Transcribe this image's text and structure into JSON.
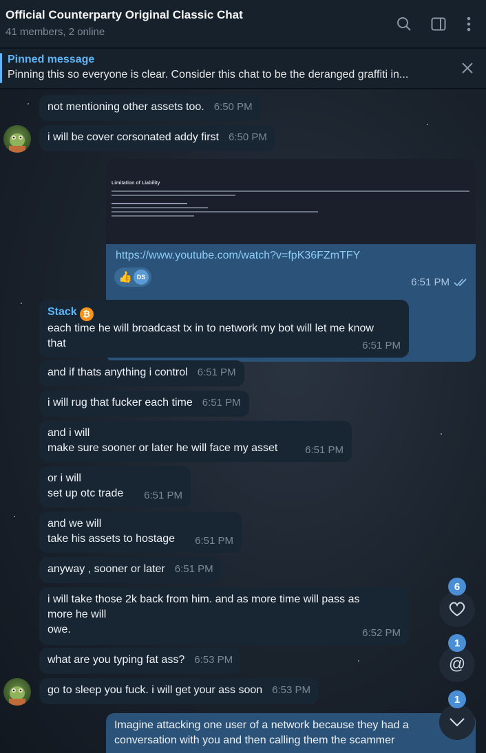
{
  "header": {
    "title": "Official Counterparty Original Classic Chat",
    "subtitle": "41 members, 2 online"
  },
  "pinned": {
    "title": "Pinned message",
    "text": "Pinning this so everyone is clear. Consider this chat to be the deranged graffiti in..."
  },
  "messages": [
    {
      "text": "not mentioning other assets too.",
      "time": "6:50 PM"
    },
    {
      "text": "i will be cover corsonated addy first",
      "time": "6:50 PM"
    },
    {
      "text": "https://www.youtube.com/watch?v=fpK36FZmTFY",
      "time": "6:51 PM",
      "preview_title": "Limitation of Liability",
      "reaction_initials": "DS",
      "reaction_emoji": "👍"
    },
    {
      "sender": "Stack",
      "sender_badge": "₿",
      "line1": "each time he will broadcast tx in to network my bot will let me know",
      "line2": "that",
      "time": "6:51 PM"
    },
    {
      "text": "and if thats anything i control",
      "time": "6:51 PM"
    },
    {
      "text": "i will rug that fucker each time",
      "time": "6:51 PM"
    },
    {
      "line1": "and i will",
      "line2": "make sure sooner or later he will face my asset",
      "time": "6:51 PM"
    },
    {
      "line1": "or i will",
      "line2": "set up otc trade",
      "time": "6:51 PM"
    },
    {
      "line1": "and we will",
      "line2": "take his assets to hostage",
      "time": "6:51 PM"
    },
    {
      "text": "anyway , sooner or later",
      "time": "6:51 PM"
    },
    {
      "line1": "i will take those 2k back from him. and as more time will pass as",
      "line2": "more he will",
      "line3": "owe.",
      "time": "6:52 PM"
    },
    {
      "text": "what are you typing fat ass?",
      "time": "6:53 PM"
    },
    {
      "text": "go to sleep you fuck. i will get your ass soon",
      "time": "6:53 PM"
    },
    {
      "line1": "Imagine attacking one user of a network because they had a",
      "line2": "conversation with you and then calling them the scammer"
    }
  ],
  "fabs": {
    "reactions_count": "6",
    "mentions_count": "1",
    "unread_count": "1"
  },
  "colors": {
    "accent": "#5eb5f7",
    "incoming_bubble": "#182533",
    "outgoing_bubble": "#2b5278",
    "header_bg": "#17212b"
  }
}
